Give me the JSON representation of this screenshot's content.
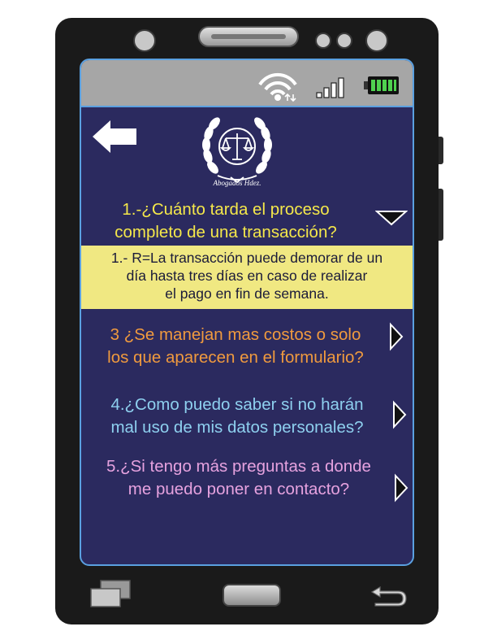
{
  "header": {
    "logo_text": "Abogados Hdez."
  },
  "faq": {
    "q1": {
      "lines": [
        "1.-¿Cuánto tarda el proceso",
        "completo de una transacción?"
      ],
      "answer_lines": [
        "1.- R=La transacción puede demorar de un",
        "día hasta tres días  en caso de realizar",
        "el pago en fin de semana."
      ]
    },
    "q3": {
      "lines": [
        "3 ¿Se manejan mas costos o solo",
        "los que aparecen en el formulario?"
      ]
    },
    "q4": {
      "lines": [
        "4.¿Como puedo saber si no harán",
        "mal uso de mis datos personales?"
      ]
    },
    "q5": {
      "lines": [
        "5.¿Si tengo más preguntas a donde",
        "me puedo poner en contacto?"
      ]
    }
  },
  "colors": {
    "screen_bg": "#2b2a5f",
    "q1": "#f5e84a",
    "answer_bg": "#f0e882",
    "q3": "#f09a3e",
    "q4": "#8ed0ef",
    "q5": "#e6a2df",
    "battery": "#4fd14f"
  },
  "icons": [
    "wifi-icon",
    "signal-icon",
    "battery-icon",
    "back-arrow-icon",
    "expand-down-icon",
    "chevron-right-icon",
    "recent-apps-icon",
    "home-button",
    "nav-back-icon"
  ]
}
